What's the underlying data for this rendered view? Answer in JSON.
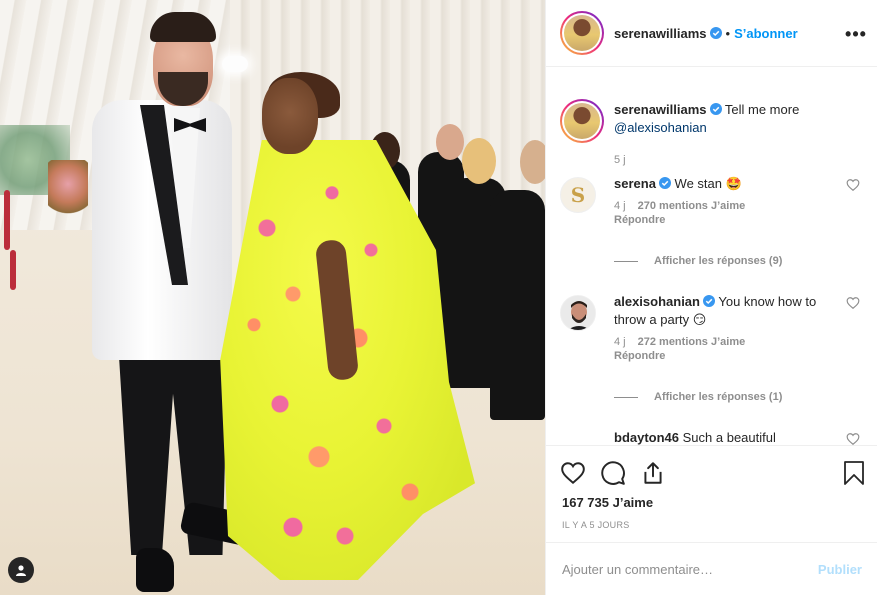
{
  "post": {
    "image_alt": "Photo",
    "author": "serenawilliams",
    "follow_label": "S’abonner",
    "more_label": "•••",
    "caption_text": "Tell me more",
    "caption_mention": "@alexisohanian",
    "caption_time": "5 j"
  },
  "comments": [
    {
      "user": "serena",
      "text": "We stan 🤩",
      "date": "4 j",
      "likes": "270 mentions J’aime",
      "reply": "Répondre",
      "view_replies": "Afficher les réponses (9)"
    },
    {
      "user": "alexisohanian",
      "text": "You know how to throw a party 😏",
      "date": "4 j",
      "likes": "272 mentions J’aime",
      "reply": "Répondre",
      "view_replies": "Afficher les réponses (1)"
    },
    {
      "user": "bdayton46",
      "text": "Such a beautiful"
    }
  ],
  "actions": {
    "like_icon": "heart-icon",
    "comment_icon": "comment-bubble-icon",
    "share_icon": "share-icon",
    "save_icon": "bookmark-icon"
  },
  "likes_count": "167 735 J’aime",
  "posted_ago": "IL Y A 5 JOURS",
  "add_comment": {
    "placeholder": "Ajouter un commentaire…",
    "publish_label": "Publier"
  },
  "colors": {
    "accent": "#0095f6",
    "text": "#262626",
    "muted": "#8e8e8e",
    "publish_disabled": "#b2dffc"
  }
}
